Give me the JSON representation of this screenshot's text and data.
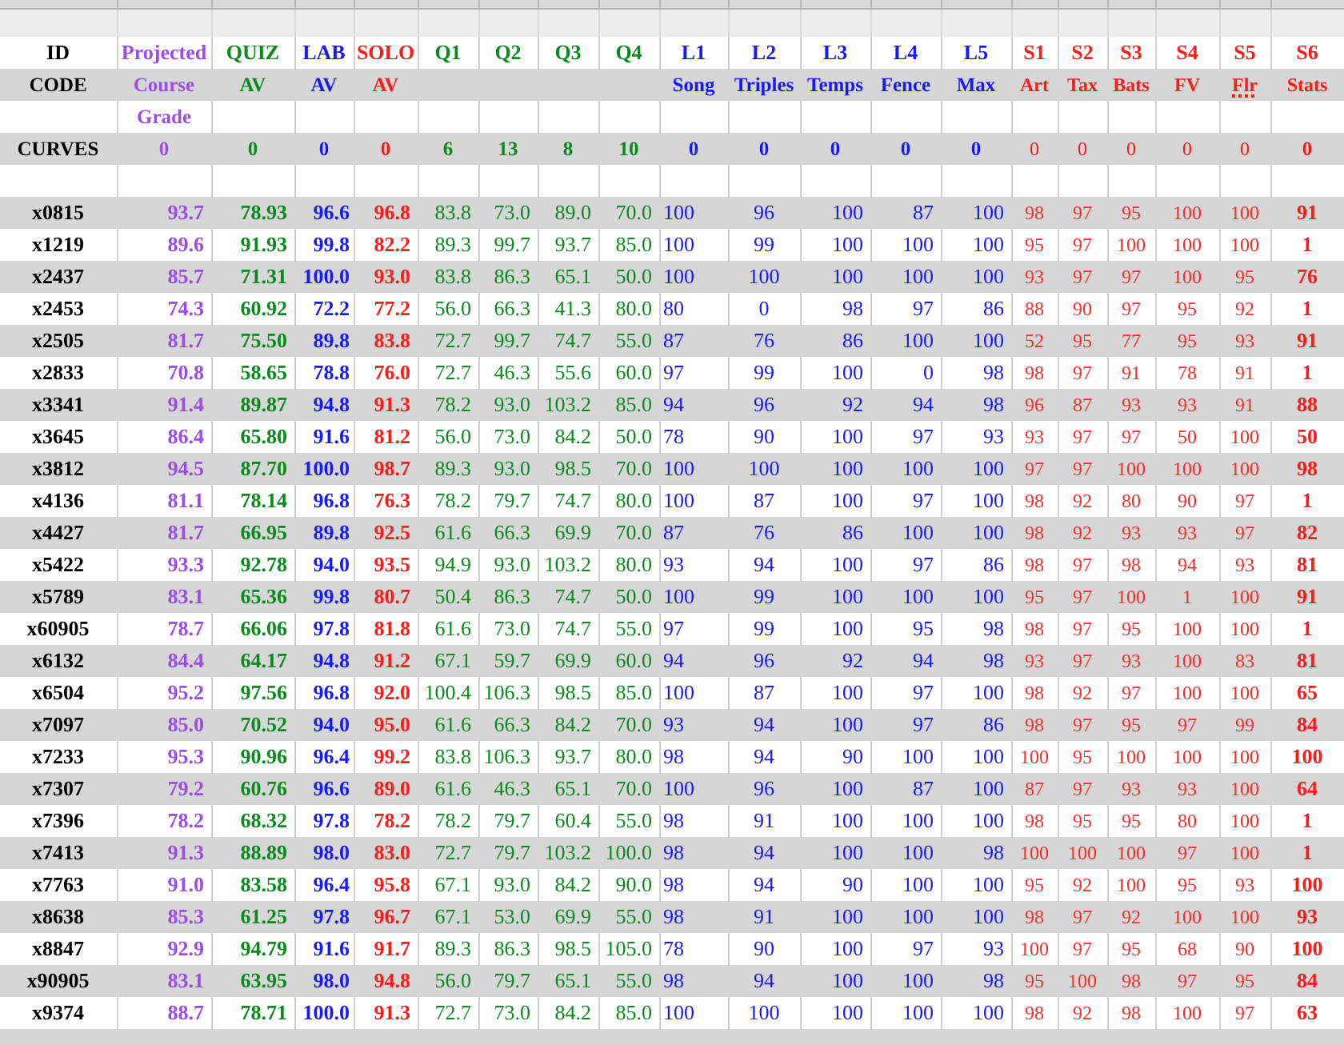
{
  "columns": [
    {
      "kind": "id",
      "label": "ID",
      "sublabel": "CODE",
      "curve_label": "CURVES"
    },
    {
      "kind": "projected",
      "label": "Projected",
      "sublabel": "Course",
      "sublabel2": "Grade",
      "curve": "0"
    },
    {
      "kind": "quiz",
      "label": "QUIZ",
      "sublabel": "AV",
      "curve": "0"
    },
    {
      "kind": "lab",
      "label": "LAB",
      "sublabel": "AV",
      "curve": "0"
    },
    {
      "kind": "solo",
      "label": "SOLO",
      "sublabel": "AV",
      "curve": "0"
    },
    {
      "kind": "q",
      "label": "Q1",
      "curve": "6"
    },
    {
      "kind": "q",
      "label": "Q2",
      "curve": "13"
    },
    {
      "kind": "q",
      "label": "Q3",
      "curve": "8"
    },
    {
      "kind": "q",
      "label": "Q4",
      "curve": "10"
    },
    {
      "kind": "l",
      "label": "L1",
      "sublabel": "Song",
      "curve": "0"
    },
    {
      "kind": "l",
      "label": "L2",
      "sublabel": "Triples",
      "curve": "0"
    },
    {
      "kind": "l",
      "label": "L3",
      "sublabel": "Temps",
      "curve": "0"
    },
    {
      "kind": "l",
      "label": "L4",
      "sublabel": "Fence",
      "curve": "0"
    },
    {
      "kind": "l",
      "label": "L5",
      "sublabel": "Max",
      "curve": "0"
    },
    {
      "kind": "s",
      "label": "S1",
      "sublabel": "Art",
      "curve": "0"
    },
    {
      "kind": "s",
      "label": "S2",
      "sublabel": "Tax",
      "curve": "0"
    },
    {
      "kind": "s",
      "label": "S3",
      "sublabel": "Bats",
      "curve": "0"
    },
    {
      "kind": "s",
      "label": "S4",
      "sublabel": "FV",
      "curve": "0"
    },
    {
      "kind": "s",
      "label": "S5",
      "sublabel": "Flr",
      "misspelled": true,
      "curve": "0"
    },
    {
      "kind": "stats",
      "label": "S6",
      "sublabel": "Stats",
      "curve": "0"
    }
  ],
  "rows": [
    [
      "x0815",
      "93.7",
      "78.93",
      "96.6",
      "96.8",
      "83.8",
      "73.0",
      "89.0",
      "70.0",
      "100",
      "96",
      "100",
      "87",
      "100",
      "98",
      "97",
      "95",
      "100",
      "100",
      "91"
    ],
    [
      "x1219",
      "89.6",
      "91.93",
      "99.8",
      "82.2",
      "89.3",
      "99.7",
      "93.7",
      "85.0",
      "100",
      "99",
      "100",
      "100",
      "100",
      "95",
      "97",
      "100",
      "100",
      "100",
      "1"
    ],
    [
      "x2437",
      "85.7",
      "71.31",
      "100.0",
      "93.0",
      "83.8",
      "86.3",
      "65.1",
      "50.0",
      "100",
      "100",
      "100",
      "100",
      "100",
      "93",
      "97",
      "97",
      "100",
      "95",
      "76"
    ],
    [
      "x2453",
      "74.3",
      "60.92",
      "72.2",
      "77.2",
      "56.0",
      "66.3",
      "41.3",
      "80.0",
      "80",
      "0",
      "98",
      "97",
      "86",
      "88",
      "90",
      "97",
      "95",
      "92",
      "1"
    ],
    [
      "x2505",
      "81.7",
      "75.50",
      "89.8",
      "83.8",
      "72.7",
      "99.7",
      "74.7",
      "55.0",
      "87",
      "76",
      "86",
      "100",
      "100",
      "52",
      "95",
      "77",
      "95",
      "93",
      "91"
    ],
    [
      "x2833",
      "70.8",
      "58.65",
      "78.8",
      "76.0",
      "72.7",
      "46.3",
      "55.6",
      "60.0",
      "97",
      "99",
      "100",
      "0",
      "98",
      "98",
      "97",
      "91",
      "78",
      "91",
      "1"
    ],
    [
      "x3341",
      "91.4",
      "89.87",
      "94.8",
      "91.3",
      "78.2",
      "93.0",
      "103.2",
      "85.0",
      "94",
      "96",
      "92",
      "94",
      "98",
      "96",
      "87",
      "93",
      "93",
      "91",
      "88"
    ],
    [
      "x3645",
      "86.4",
      "65.80",
      "91.6",
      "81.2",
      "56.0",
      "73.0",
      "84.2",
      "50.0",
      "78",
      "90",
      "100",
      "97",
      "93",
      "93",
      "97",
      "97",
      "50",
      "100",
      "50"
    ],
    [
      "x3812",
      "94.5",
      "87.70",
      "100.0",
      "98.7",
      "89.3",
      "93.0",
      "98.5",
      "70.0",
      "100",
      "100",
      "100",
      "100",
      "100",
      "97",
      "97",
      "100",
      "100",
      "100",
      "98"
    ],
    [
      "x4136",
      "81.1",
      "78.14",
      "96.8",
      "76.3",
      "78.2",
      "79.7",
      "74.7",
      "80.0",
      "100",
      "87",
      "100",
      "97",
      "100",
      "98",
      "92",
      "80",
      "90",
      "97",
      "1"
    ],
    [
      "x4427",
      "81.7",
      "66.95",
      "89.8",
      "92.5",
      "61.6",
      "66.3",
      "69.9",
      "70.0",
      "87",
      "76",
      "86",
      "100",
      "100",
      "98",
      "92",
      "93",
      "93",
      "97",
      "82"
    ],
    [
      "x5422",
      "93.3",
      "92.78",
      "94.0",
      "93.5",
      "94.9",
      "93.0",
      "103.2",
      "80.0",
      "93",
      "94",
      "100",
      "97",
      "86",
      "98",
      "97",
      "98",
      "94",
      "93",
      "81"
    ],
    [
      "x5789",
      "83.1",
      "65.36",
      "99.8",
      "80.7",
      "50.4",
      "86.3",
      "74.7",
      "50.0",
      "100",
      "99",
      "100",
      "100",
      "100",
      "95",
      "97",
      "100",
      "1",
      "100",
      "91"
    ],
    [
      "x60905",
      "78.7",
      "66.06",
      "97.8",
      "81.8",
      "61.6",
      "73.0",
      "74.7",
      "55.0",
      "97",
      "99",
      "100",
      "95",
      "98",
      "98",
      "97",
      "95",
      "100",
      "100",
      "1"
    ],
    [
      "x6132",
      "84.4",
      "64.17",
      "94.8",
      "91.2",
      "67.1",
      "59.7",
      "69.9",
      "60.0",
      "94",
      "96",
      "92",
      "94",
      "98",
      "93",
      "97",
      "93",
      "100",
      "83",
      "81"
    ],
    [
      "x6504",
      "95.2",
      "97.56",
      "96.8",
      "92.0",
      "100.4",
      "106.3",
      "98.5",
      "85.0",
      "100",
      "87",
      "100",
      "97",
      "100",
      "98",
      "92",
      "97",
      "100",
      "100",
      "65"
    ],
    [
      "x7097",
      "85.0",
      "70.52",
      "94.0",
      "95.0",
      "61.6",
      "66.3",
      "84.2",
      "70.0",
      "93",
      "94",
      "100",
      "97",
      "86",
      "98",
      "97",
      "95",
      "97",
      "99",
      "84"
    ],
    [
      "x7233",
      "95.3",
      "90.96",
      "96.4",
      "99.2",
      "83.8",
      "106.3",
      "93.7",
      "80.0",
      "98",
      "94",
      "90",
      "100",
      "100",
      "100",
      "95",
      "100",
      "100",
      "100",
      "100"
    ],
    [
      "x7307",
      "79.2",
      "60.76",
      "96.6",
      "89.0",
      "61.6",
      "46.3",
      "65.1",
      "70.0",
      "100",
      "96",
      "100",
      "87",
      "100",
      "87",
      "97",
      "93",
      "93",
      "100",
      "64"
    ],
    [
      "x7396",
      "78.2",
      "68.32",
      "97.8",
      "78.2",
      "78.2",
      "79.7",
      "60.4",
      "55.0",
      "98",
      "91",
      "100",
      "100",
      "100",
      "98",
      "95",
      "95",
      "80",
      "100",
      "1"
    ],
    [
      "x7413",
      "91.3",
      "88.89",
      "98.0",
      "83.0",
      "72.7",
      "79.7",
      "103.2",
      "100.0",
      "98",
      "94",
      "100",
      "100",
      "98",
      "100",
      "100",
      "100",
      "97",
      "100",
      "1"
    ],
    [
      "x7763",
      "91.0",
      "83.58",
      "96.4",
      "95.8",
      "67.1",
      "93.0",
      "84.2",
      "90.0",
      "98",
      "94",
      "90",
      "100",
      "100",
      "95",
      "92",
      "100",
      "95",
      "93",
      "100"
    ],
    [
      "x8638",
      "85.3",
      "61.25",
      "97.8",
      "96.7",
      "67.1",
      "53.0",
      "69.9",
      "55.0",
      "98",
      "91",
      "100",
      "100",
      "100",
      "98",
      "97",
      "92",
      "100",
      "100",
      "93"
    ],
    [
      "x8847",
      "92.9",
      "94.79",
      "91.6",
      "91.7",
      "89.3",
      "86.3",
      "98.5",
      "105.0",
      "78",
      "90",
      "100",
      "97",
      "93",
      "100",
      "97",
      "95",
      "68",
      "90",
      "100"
    ],
    [
      "x90905",
      "83.1",
      "63.95",
      "98.0",
      "94.8",
      "56.0",
      "79.7",
      "65.1",
      "55.0",
      "98",
      "94",
      "100",
      "100",
      "98",
      "95",
      "100",
      "98",
      "97",
      "95",
      "84"
    ],
    [
      "x9374",
      "88.7",
      "78.71",
      "100.0",
      "91.3",
      "72.7",
      "73.0",
      "84.2",
      "85.0",
      "100",
      "100",
      "100",
      "100",
      "100",
      "98",
      "92",
      "98",
      "100",
      "97",
      "63"
    ]
  ]
}
